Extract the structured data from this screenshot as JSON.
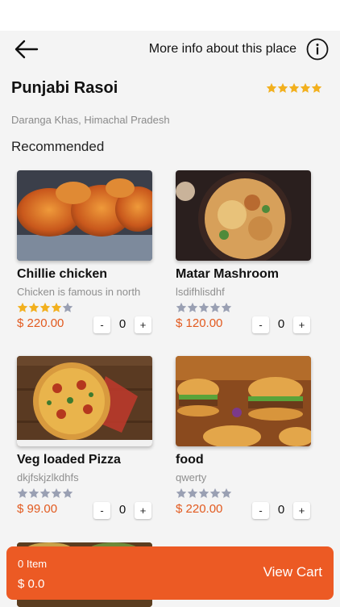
{
  "header": {
    "more_info_label": "More info about this place",
    "back_icon": "arrow-left-icon",
    "info_icon": "info-circle-icon"
  },
  "restaurant": {
    "name": "Punjabi Rasoi",
    "location": "Daranga Khas, Himachal Pradesh",
    "rating": 5
  },
  "section": {
    "title": "Recommended"
  },
  "items": [
    {
      "title": "Chillie chicken",
      "desc": "Chicken is famous in north",
      "rating": 4,
      "price": "$ 220.00",
      "qty": "0",
      "minus": "-",
      "plus": "+"
    },
    {
      "title": "Matar Mashroom",
      "desc": "lsdifhlisdhf",
      "rating": 0,
      "price": "$ 120.00",
      "qty": "0",
      "minus": "-",
      "plus": "+"
    },
    {
      "title": "Veg loaded Pizza",
      "desc": "dkjfskjzlkdhfs",
      "rating": 0,
      "price": "$ 99.00",
      "qty": "0",
      "minus": "-",
      "plus": "+"
    },
    {
      "title": "food",
      "desc": "qwerty",
      "rating": 0,
      "price": "$ 220.00",
      "qty": "0",
      "minus": "-",
      "plus": "+"
    }
  ],
  "cart": {
    "items_label": "0 Item",
    "total": "$ 0.0",
    "view_label": "View Cart"
  },
  "colors": {
    "accent": "#ec5a24",
    "price": "#e25a1f",
    "star_filled": "#f2b01e",
    "star_empty": "#9aa0b3"
  }
}
